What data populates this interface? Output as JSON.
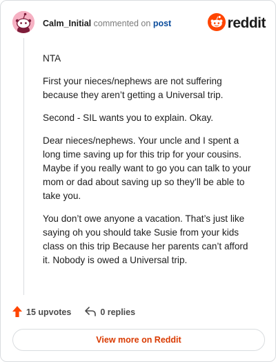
{
  "header": {
    "author": "Calm_Initial",
    "commented_text": "commented on",
    "post_link": "post",
    "logo_text": "reddit"
  },
  "comment": {
    "paragraphs": [
      "NTA",
      "First your nieces/nephews are not suffering because they aren’t getting a Universal trip.",
      "Second - SIL wants you to explain. Okay.",
      "Dear nieces/nephews. Your uncle and I spent a long time saving up for this trip for your cousins. Maybe if you really want to go you can talk to your mom or dad about saving up so they’ll be able to take you.",
      "You don’t owe anyone a vacation. That’s just like saying oh you should take Susie from your kids class on this trip Because her parents can’t afford it. Nobody is owed a Universal trip."
    ]
  },
  "actions": {
    "upvotes": "15 upvotes",
    "replies": "0 replies"
  },
  "footer": {
    "view_more": "View more on Reddit"
  },
  "colors": {
    "brand": "#ff4500",
    "link": "#0a4c9c",
    "view_more": "#d93a00"
  },
  "icons": {
    "avatar": "snoo-avatar-icon",
    "logo": "reddit-snoo-icon",
    "upvote": "upvote-arrow-icon",
    "reply": "reply-arrow-icon"
  }
}
